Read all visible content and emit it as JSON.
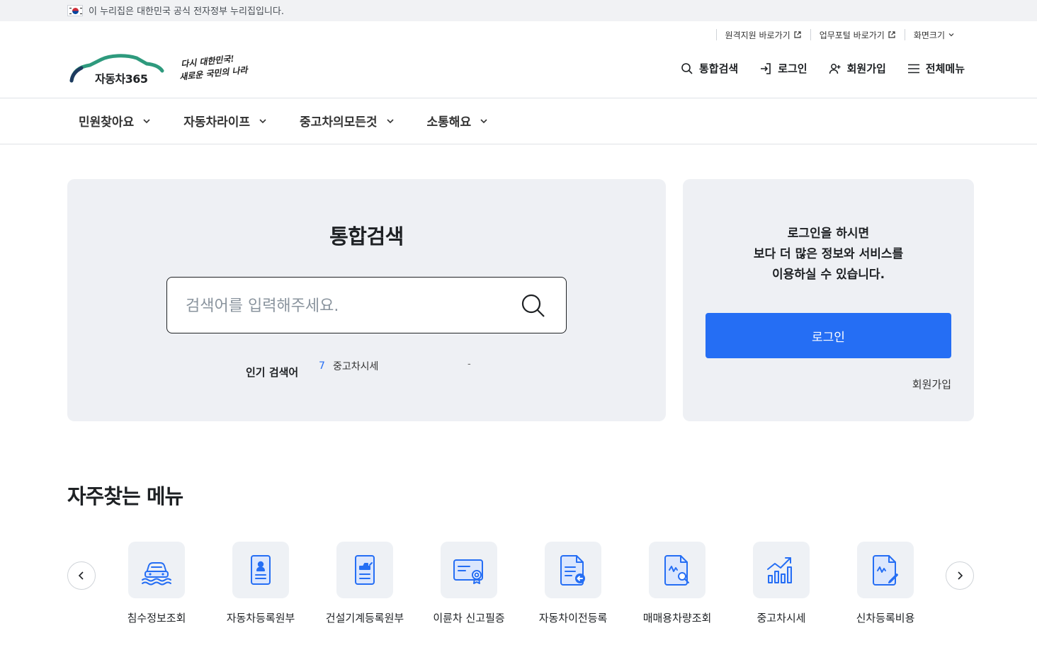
{
  "gov_banner": {
    "text": "이 누리집은 대한민국 공식 전자정부 누리집입니다."
  },
  "utility": {
    "remote_support": "원격지원 바로가기",
    "work_portal": "업무포털 바로가기",
    "screen_size": "화면크기"
  },
  "logo": {
    "name": "자동차365"
  },
  "slogan": {
    "line1": "다시 대한민국!",
    "line2": "새로운 국민의 나라"
  },
  "header": {
    "search": "통합검색",
    "login": "로그인",
    "join": "회원가입",
    "all_menu": "전체메뉴"
  },
  "gnb": [
    "민원찾아요",
    "자동차라이프",
    "중고차의모든것",
    "소통해요"
  ],
  "search": {
    "title": "통합검색",
    "placeholder": "검색어를 입력해주세요.",
    "popular_label": "인기 검색어",
    "popular": [
      {
        "rank": "7",
        "term": "중고차시세"
      }
    ],
    "dash": "-"
  },
  "login_panel": {
    "line1": "로그인을 하시면",
    "line2": "보다 더 많은 정보와 서비스를",
    "line3": "이용하실 수 있습니다.",
    "button": "로그인",
    "join": "회원가입"
  },
  "frequent": {
    "title": "자주찾는 메뉴",
    "items": [
      {
        "label": "침수정보조회",
        "icon": "flooded-car-icon"
      },
      {
        "label": "자동차등록원부",
        "icon": "registration-card-icon"
      },
      {
        "label": "건설기계등록원부",
        "icon": "construction-document-icon"
      },
      {
        "label": "이륜차 신고필증",
        "icon": "certificate-card-icon"
      },
      {
        "label": "자동차이전등록",
        "icon": "transfer-document-icon"
      },
      {
        "label": "매매용차량조회",
        "icon": "search-document-icon"
      },
      {
        "label": "중고차시세",
        "icon": "rising-chart-icon"
      },
      {
        "label": "신차등록비용",
        "icon": "cost-document-icon"
      }
    ]
  },
  "colors": {
    "primary": "#256ef4",
    "card_bg": "#eef0f4",
    "icon_blue": "#256ef4",
    "logo_green": "#2e9a7d"
  }
}
